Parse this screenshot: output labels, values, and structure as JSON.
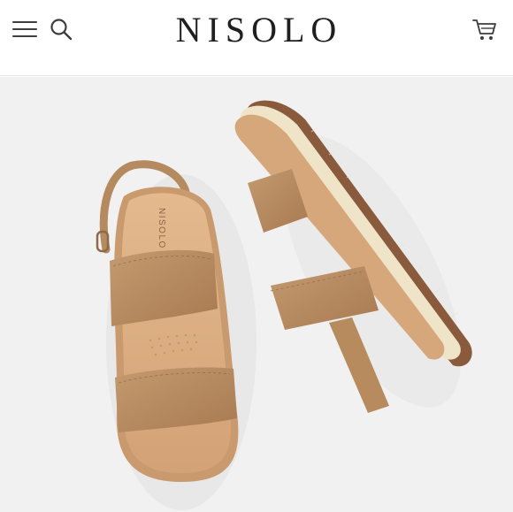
{
  "header": {
    "brand": "NISOLO",
    "menu_icon": "hamburger-menu-icon",
    "search_icon": "search-icon",
    "cart_icon": "shopping-cart-icon"
  },
  "product_image": {
    "insole_stamp": "NISOLO",
    "colors": {
      "leather": "#b98d62",
      "footbed": "#dcae82",
      "sole_cream": "#efe3c8",
      "tread": "#8a5a3c",
      "background": "#f1f1f1"
    }
  }
}
